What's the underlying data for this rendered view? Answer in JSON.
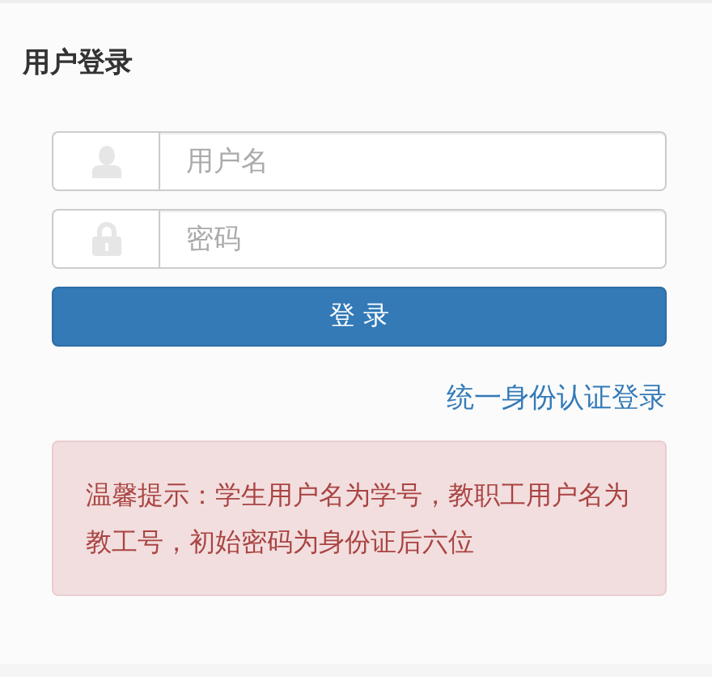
{
  "title": "用户登录",
  "fields": [
    {
      "kind": "user",
      "placeholder": "用户名"
    },
    {
      "kind": "lock",
      "placeholder": "密码"
    }
  ],
  "login_button": "登 录",
  "sso_link": "统一身份认证登录",
  "notice": "温馨提示：学生用户名为学号，教职工用户名为教工号，初始密码为身份证后六位"
}
